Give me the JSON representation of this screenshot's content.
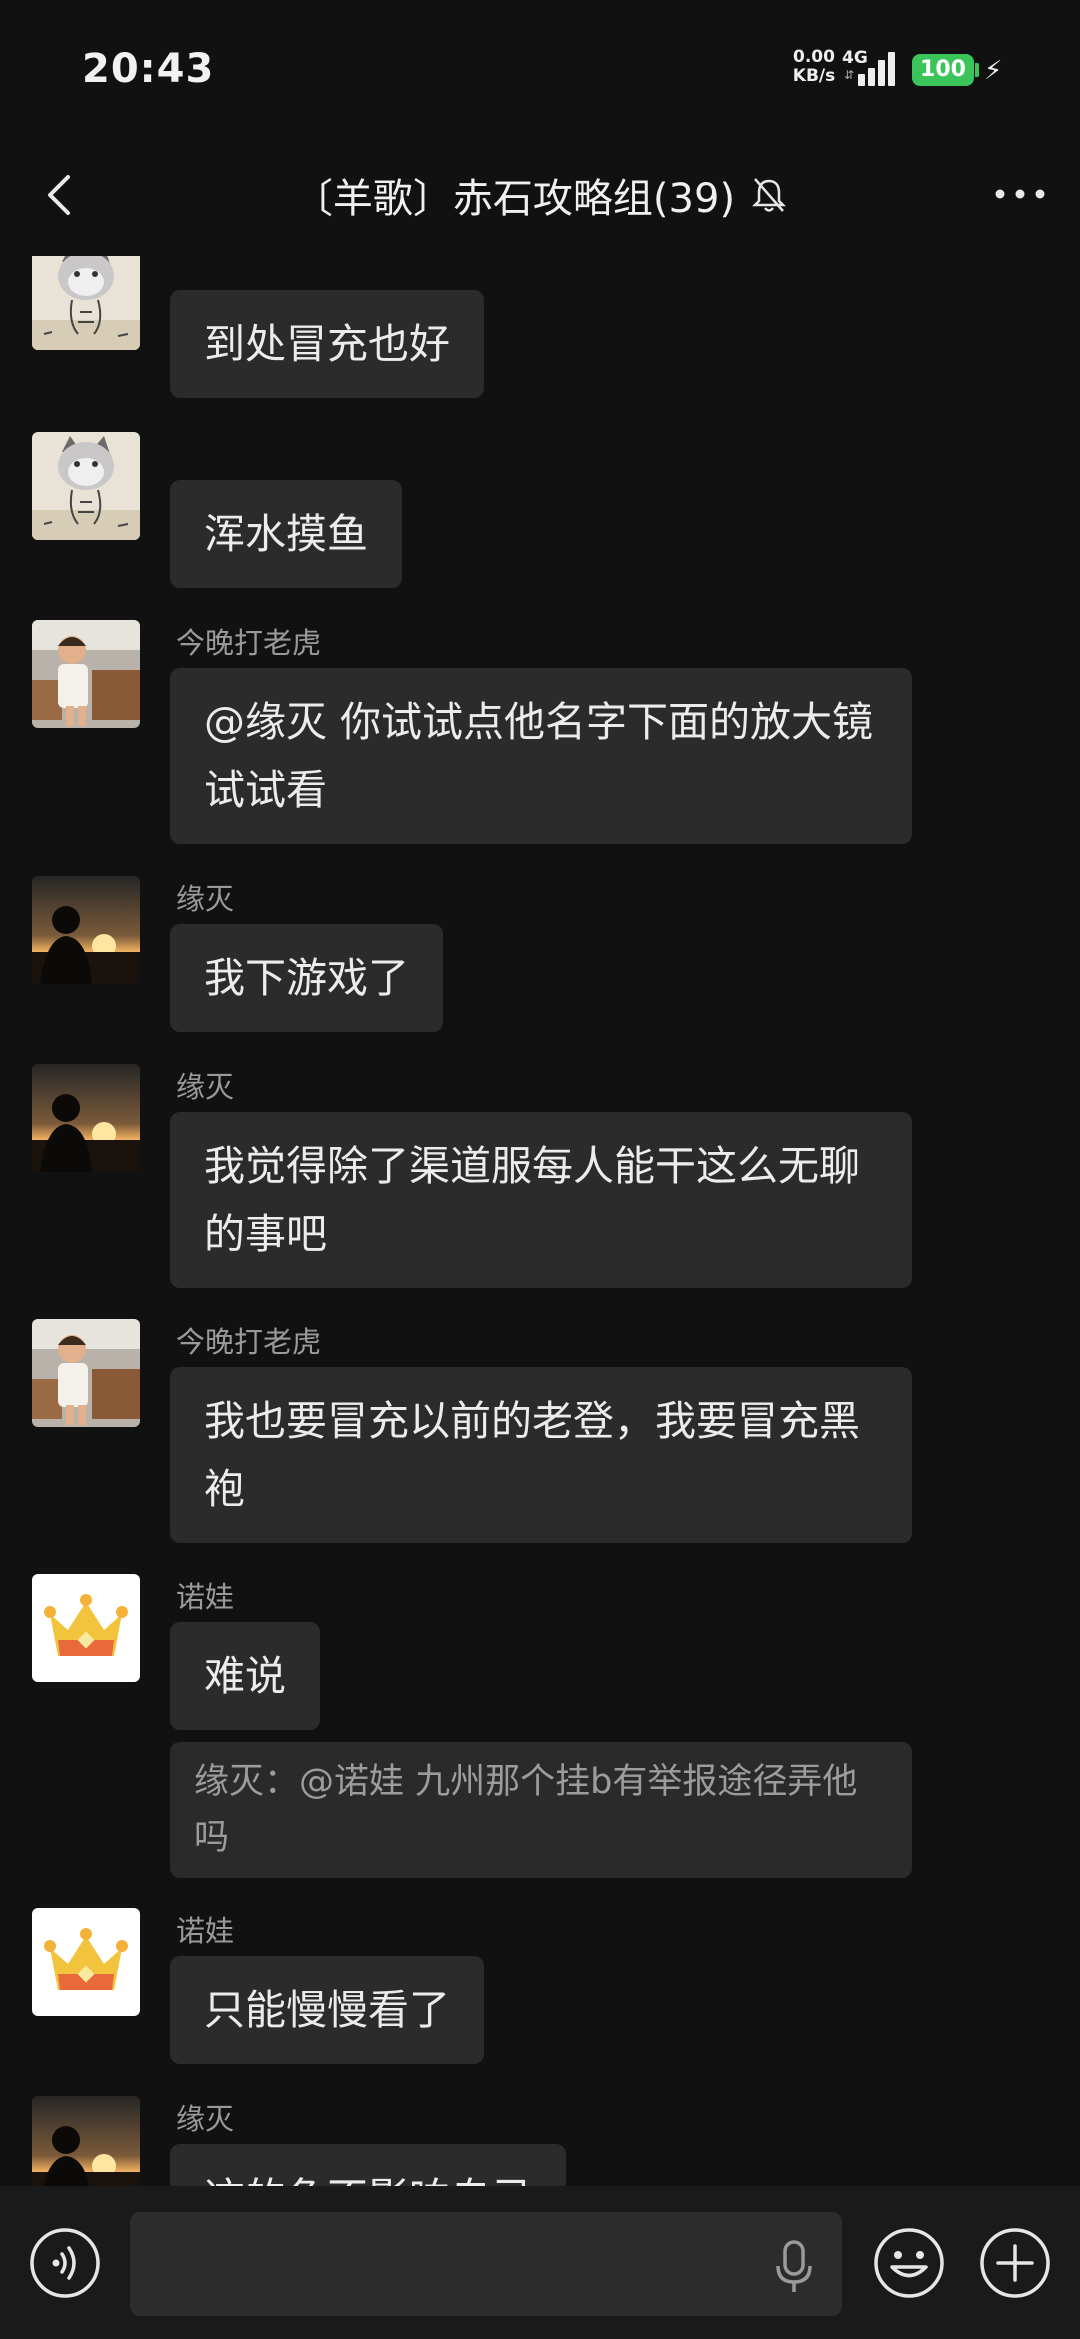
{
  "status_bar": {
    "time": "20:43",
    "net_speed_value": "0.00",
    "net_speed_unit": "KB/s",
    "network": "4G",
    "battery": "100"
  },
  "header": {
    "title": "〔羊歌〕赤石攻略组(39)"
  },
  "colors": {
    "background": "#111111",
    "bubble": "#2b2b2b",
    "battery": "#3ac45a"
  },
  "messages": [
    {
      "avatar": "cat-avatar",
      "name": "",
      "text": "到处冒充也好"
    },
    {
      "avatar": "cat-avatar",
      "name": "",
      "text": "浑水摸鱼"
    },
    {
      "avatar": "kid-avatar",
      "name": "今晚打老虎",
      "text": "@缘灭  你试试点他名字下面的放大镜试试看"
    },
    {
      "avatar": "sunset-avatar",
      "name": "缘灭",
      "text": "我下游戏了"
    },
    {
      "avatar": "sunset-avatar",
      "name": "缘灭",
      "text": "我觉得除了渠道服每人能干这么无聊的事吧"
    },
    {
      "avatar": "kid-avatar",
      "name": "今晚打老虎",
      "text": "我也要冒充以前的老登，我要冒充黑袍"
    },
    {
      "avatar": "crown-avatar",
      "name": "诺娃",
      "text": "难说",
      "quote": "缘灭：@诺娃 九州那个挂b有举报途径弄他吗"
    },
    {
      "avatar": "crown-avatar",
      "name": "诺娃",
      "text": "只能慢慢看了"
    },
    {
      "avatar": "sunset-avatar",
      "name": "缘灭",
      "text": "这的鱼不影响自己"
    }
  ],
  "input_bar": {
    "voice_icon": "voice-icon",
    "mic_icon": "mic-icon",
    "emoji_icon": "emoji-icon",
    "plus_icon": "plus-icon"
  }
}
